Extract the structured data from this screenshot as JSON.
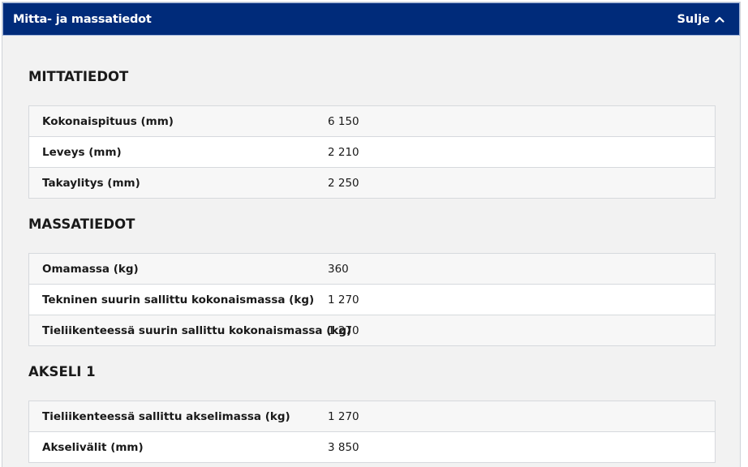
{
  "header": {
    "title": "Mitta- ja massatiedot",
    "close_label": "Sulje"
  },
  "sections": [
    {
      "title": "MITTATIEDOT",
      "rows": [
        {
          "label": "Kokonaispituus (mm)",
          "value": "6 150"
        },
        {
          "label": "Leveys (mm)",
          "value": "2 210"
        },
        {
          "label": "Takaylitys (mm)",
          "value": "2 250"
        }
      ]
    },
    {
      "title": "MASSATIEDOT",
      "rows": [
        {
          "label": "Omamassa (kg)",
          "value": "360"
        },
        {
          "label": "Tekninen suurin sallittu kokonaismassa (kg)",
          "value": "1 270"
        },
        {
          "label": "Tieliikenteessä suurin sallittu kokonaismassa (kg)",
          "value": "1 270"
        }
      ]
    },
    {
      "title": "AKSELI 1",
      "rows": [
        {
          "label": "Tieliikenteessä sallittu akselimassa (kg)",
          "value": "1 270"
        },
        {
          "label": "Akselivälit (mm)",
          "value": "3 850"
        }
      ]
    }
  ],
  "icons": {
    "close": "chevron-up-icon"
  },
  "colors": {
    "header_bg": "#002b7a",
    "panel_bg": "#f2f2f2"
  }
}
